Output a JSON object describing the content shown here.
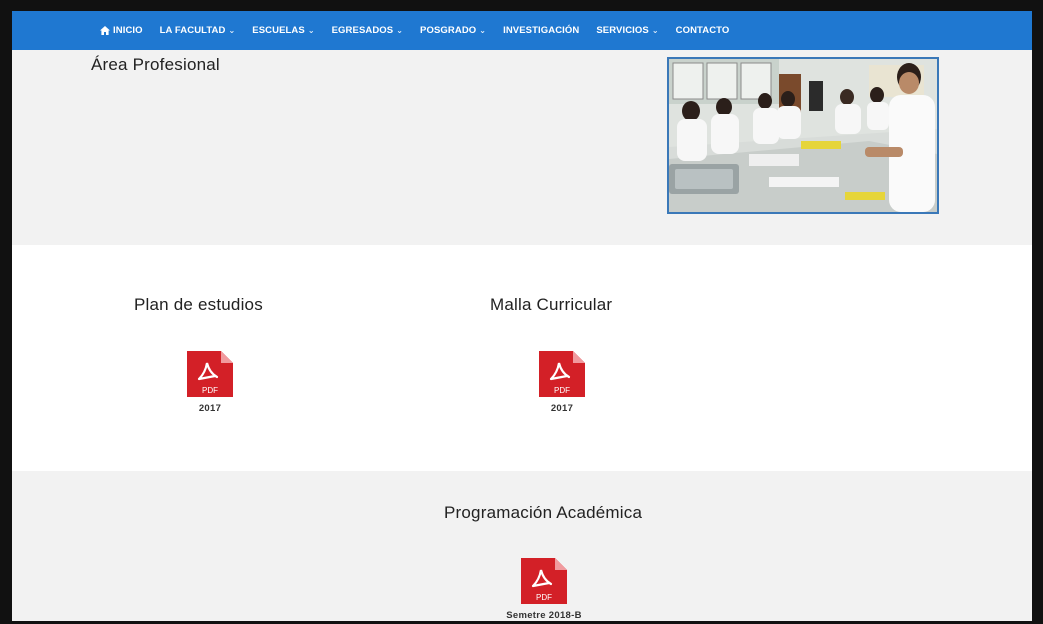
{
  "nav": {
    "items": [
      {
        "label": "INICIO",
        "has_dropdown": false,
        "icon": "home-icon"
      },
      {
        "label": "LA FACULTAD",
        "has_dropdown": true
      },
      {
        "label": "ESCUELAS",
        "has_dropdown": true
      },
      {
        "label": "EGRESADOS",
        "has_dropdown": true
      },
      {
        "label": "POSGRADO",
        "has_dropdown": true
      },
      {
        "label": "INVESTIGACIÓN",
        "has_dropdown": false
      },
      {
        "label": "SERVICIOS",
        "has_dropdown": true
      },
      {
        "label": "CONTACTO",
        "has_dropdown": false
      }
    ],
    "dropdown_glyph": "⌄",
    "bg_color": "#1f78d1"
  },
  "hero": {
    "title": "Área Profesional"
  },
  "documents": {
    "plan": {
      "title": "Plan de estudios",
      "caption": "2017"
    },
    "malla": {
      "title": "Malla Curricular",
      "caption": "2017"
    },
    "programacion": {
      "title": "Programación Académica",
      "caption": "Semetre 2018-B"
    }
  },
  "pdf_icon": {
    "label": "PDF",
    "color": "#d32027"
  }
}
